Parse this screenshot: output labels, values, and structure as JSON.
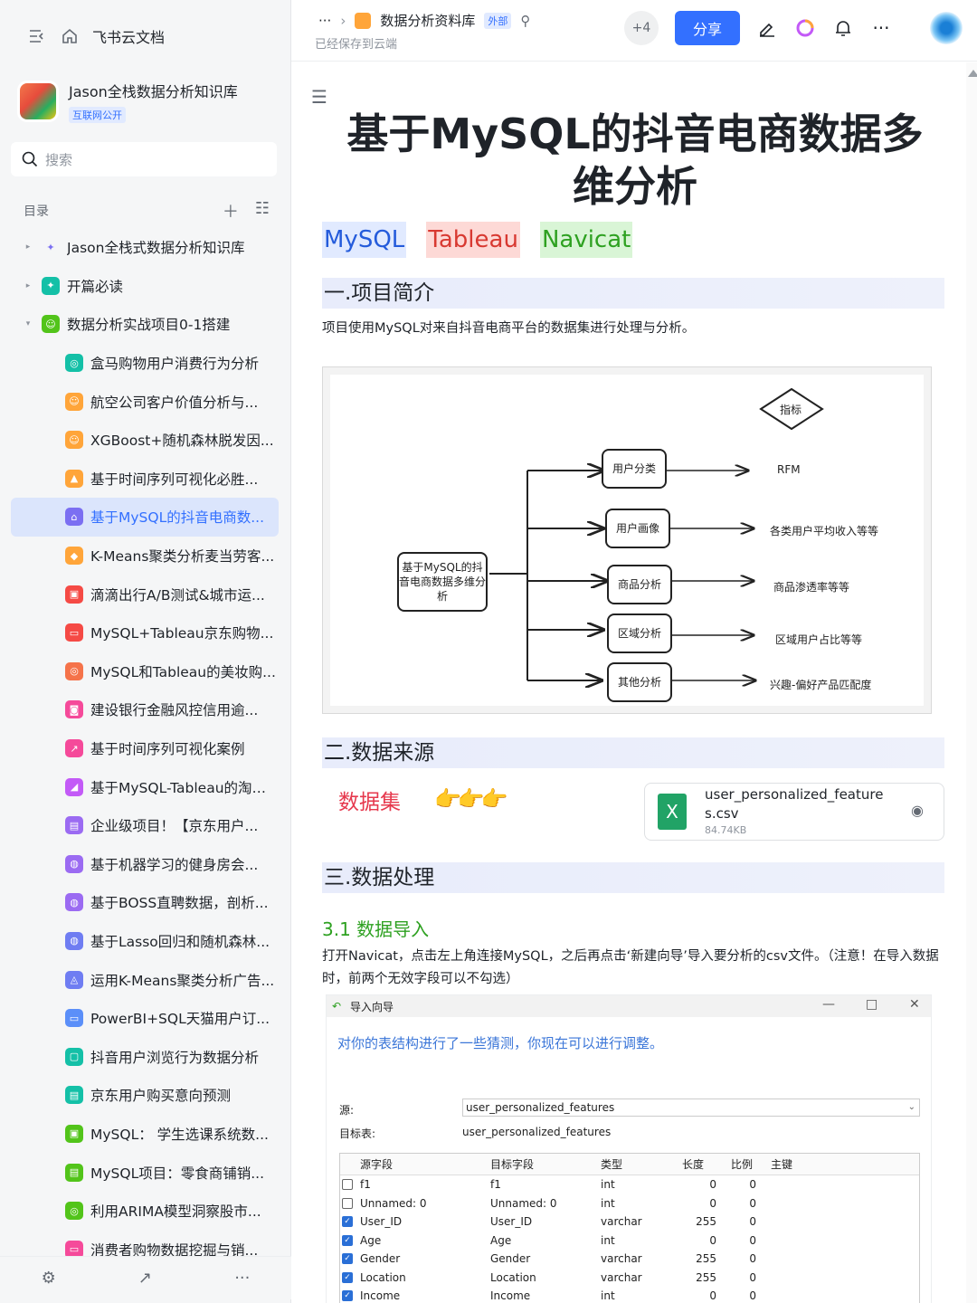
{
  "sidebar": {
    "app_title": "飞书云文档",
    "kb_title": "Jason全栈数据分析知识库",
    "kb_badge": "互联网公开",
    "search_placeholder": "搜索",
    "toc_label": "目录",
    "items": [
      {
        "label": "Jason全栈式数据分析知识库",
        "color": "#ffffff",
        "glyph": "✦",
        "level": 1,
        "arrow": "▸"
      },
      {
        "label": "开篇必读",
        "color": "#14c0a7",
        "glyph": "✦",
        "level": 1,
        "arrow": "▸"
      },
      {
        "label": "数据分析实战项目0-1搭建",
        "color": "#52c41a",
        "glyph": "☺",
        "level": 1,
        "arrow": "▾"
      },
      {
        "label": "盒马购物用户消费行为分析",
        "color": "#14c0a7",
        "glyph": "◎",
        "level": 2
      },
      {
        "label": "航空公司客户价值分析与...",
        "color": "#ffa53a",
        "glyph": "☺",
        "level": 2
      },
      {
        "label": "XGBoost+随机森林脱发因...",
        "color": "#ffa53a",
        "glyph": "☺",
        "level": 2
      },
      {
        "label": "基于时间序列可视化必胜...",
        "color": "#ffa53a",
        "glyph": "▲",
        "level": 2
      },
      {
        "label": "基于MySQL的抖音电商数...",
        "color": "#7b6ff2",
        "glyph": "⌂",
        "level": 2,
        "active": true
      },
      {
        "label": "K-Means聚类分析麦当劳客...",
        "color": "#ffa53a",
        "glyph": "◆",
        "level": 2
      },
      {
        "label": "滴滴出行A/B测试&城市运...",
        "color": "#f54a45",
        "glyph": "▣",
        "level": 2
      },
      {
        "label": "MySQL+Tableau京东购物...",
        "color": "#f54a45",
        "glyph": "▭",
        "level": 2
      },
      {
        "label": "MySQL和Tableau的美妆购...",
        "color": "#f5734a",
        "glyph": "◎",
        "level": 2
      },
      {
        "label": "建设银行金融风控信用逾...",
        "color": "#f54a9a",
        "glyph": "◙",
        "level": 2
      },
      {
        "label": "基于时间序列可视化案例",
        "color": "#f54a9a",
        "glyph": "↗",
        "level": 2
      },
      {
        "label": "基于MySQL-Tableau的淘宝...",
        "color": "#c35af7",
        "glyph": "◢",
        "level": 2
      },
      {
        "label": "企业级项目！【京东用户...",
        "color": "#9b6bf2",
        "glyph": "▤",
        "level": 2
      },
      {
        "label": "基于机器学习的健身房会...",
        "color": "#9b6bf2",
        "glyph": "◍",
        "level": 2
      },
      {
        "label": "基于BOSS直聘数据，剖析...",
        "color": "#9b6bf2",
        "glyph": "◍",
        "level": 2
      },
      {
        "label": "基于Lasso回归和随机森林...",
        "color": "#6f7df2",
        "glyph": "◍",
        "level": 2
      },
      {
        "label": "运用K-Means聚类分析广告...",
        "color": "#6f7df2",
        "glyph": "◬",
        "level": 2
      },
      {
        "label": "PowerBI+SQL天猫用户订...",
        "color": "#5b8ff9",
        "glyph": "▭",
        "level": 2
      },
      {
        "label": "抖音用户浏览行为数据分析",
        "color": "#14c0a7",
        "glyph": "▢",
        "level": 2
      },
      {
        "label": "京东用户购买意向预测",
        "color": "#14c0a7",
        "glyph": "▤",
        "level": 2
      },
      {
        "label": "MySQL： 学生选课系统数...",
        "color": "#52c41a",
        "glyph": "▣",
        "level": 2
      },
      {
        "label": "MySQL项目：零食商铺销...",
        "color": "#52c41a",
        "glyph": "▤",
        "level": 2
      },
      {
        "label": "利用ARIMA模型洞察股市...",
        "color": "#52c41a",
        "glyph": "◎",
        "level": 2
      },
      {
        "label": "消费者购物数据挖掘与销...",
        "color": "#f54a9a",
        "glyph": "▭",
        "level": 2
      }
    ]
  },
  "header": {
    "breadcrumb_more": "···",
    "breadcrumb_sep": "›",
    "folder_name": "数据分析资料库",
    "external_badge": "外部",
    "saved_status": "已经保存到云端",
    "collab_count": "+4",
    "share_label": "分享",
    "more_label": "···"
  },
  "doc": {
    "title": "基于MySQL的抖音电商数据多维分析",
    "tags": [
      {
        "label": "MySQL",
        "fg": "#245bdb",
        "bg": "#e1eaff"
      },
      {
        "label": "Tableau",
        "fg": "#d83931",
        "bg": "#fdd9d6"
      },
      {
        "label": "Navicat",
        "fg": "#2ea121",
        "bg": "#d9f5d6"
      }
    ],
    "section1": "一.项目简介",
    "intro": "项目使用MySQL对来自抖音电商平台的数据集进行处理与分析。",
    "diagram": {
      "root": "基于MySQL的抖音电商数据多维分析",
      "top": "指标",
      "branches": [
        {
          "node": "用户分类",
          "result": "RFM"
        },
        {
          "node": "用户画像",
          "result": "各类用户平均收入等等"
        },
        {
          "node": "商品分析",
          "result": "商品渗透率等等"
        },
        {
          "node": "区域分析",
          "result": "区域用户占比等等"
        },
        {
          "node": "其他分析",
          "result": "兴趣-偏好产品匹配度"
        }
      ]
    },
    "section2": "二.数据来源",
    "dataset_label": "数据集",
    "hands": "👉👉👉",
    "file": {
      "name": "user_personalized_features.csv",
      "size": "84.74KB"
    },
    "section3": "三.数据处理",
    "sub31": "3.1 数据导入",
    "import_text": "打开Navicat，点击左上角连接MySQL，之后再点击‘新建向导’导入要分析的csv文件。（注意！在导入数据时，前两个无效字段可以不勾选）"
  },
  "wizard": {
    "title": "导入向导",
    "hint": "对你的表结构进行了一些猜测，你现在可以进行调整。",
    "source_label": "源:",
    "source_value": "user_personalized_features",
    "target_label": "目标表:",
    "target_value": "user_personalized_features",
    "columns": [
      "源字段",
      "目标字段",
      "类型",
      "长度",
      "比例",
      "主键"
    ],
    "rows": [
      {
        "checked": false,
        "src": "f1",
        "dst": "f1",
        "type": "int",
        "len": "0",
        "scale": "0"
      },
      {
        "checked": false,
        "src": "Unnamed: 0",
        "dst": "Unnamed: 0",
        "type": "int",
        "len": "0",
        "scale": "0"
      },
      {
        "checked": true,
        "src": "User_ID",
        "dst": "User_ID",
        "type": "varchar",
        "len": "255",
        "scale": "0"
      },
      {
        "checked": true,
        "src": "Age",
        "dst": "Age",
        "type": "int",
        "len": "0",
        "scale": "0"
      },
      {
        "checked": true,
        "src": "Gender",
        "dst": "Gender",
        "type": "varchar",
        "len": "255",
        "scale": "0"
      },
      {
        "checked": true,
        "src": "Location",
        "dst": "Location",
        "type": "varchar",
        "len": "255",
        "scale": "0"
      },
      {
        "checked": true,
        "src": "Income",
        "dst": "Income",
        "type": "int",
        "len": "0",
        "scale": "0"
      }
    ]
  }
}
